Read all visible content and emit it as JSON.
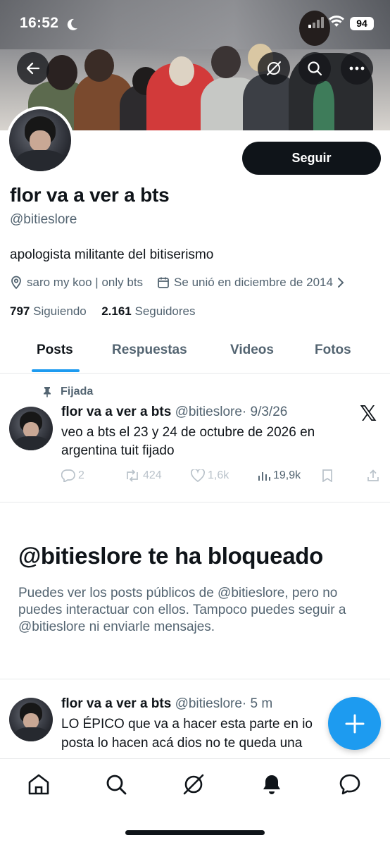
{
  "status_bar": {
    "time": "16:52",
    "battery": "94"
  },
  "header_buttons": [
    "back-arrow-icon",
    "circle-slash-icon",
    "search-icon",
    "more-icon"
  ],
  "profile": {
    "follow_label": "Seguir",
    "name": "flor va a ver a bts",
    "handle": "@bitieslore",
    "bio": "apologista militante del bitiserismo",
    "location": "saro my koo | only bts",
    "joined": "Se unió en diciembre de 2014",
    "following_count": "797",
    "following_label": "Siguiendo",
    "followers_count": "2.161",
    "followers_label": "Seguidores"
  },
  "tabs": [
    "Posts",
    "Respuestas",
    "Videos",
    "Fotos"
  ],
  "pinned_tweet": {
    "pin_label": "Fijada",
    "author": "flor va a ver a bts",
    "handle": "@bitieslore",
    "time": "· 9/3/26",
    "text": "veo a bts el 23 y 24 de octubre de 2026 en argentina tuit fijado",
    "replies": "2",
    "retweets": "424",
    "likes": "1,6k",
    "views": "19,9k"
  },
  "blocked": {
    "title": "@bitieslore te ha bloqueado",
    "text": "Puedes ver los posts públicos de @bitieslore, pero no puedes interactuar con ellos. Tampoco puedes seguir a @bitieslore ni enviarle mensajes."
  },
  "second_tweet": {
    "author": "flor va a ver a bts",
    "handle": "@bitieslore",
    "time": "· 5 m",
    "line1": "LO ÉPICO que va a hacer esta parte en io",
    "line2": "posta lo hacen acá dios no te queda una"
  },
  "bottom_nav": [
    "home-icon",
    "search-icon",
    "grok-icon",
    "bell-icon",
    "messages-icon"
  ],
  "colors": {
    "accent": "#1d9bf0",
    "text": "#0f1419",
    "secondary": "#536471"
  }
}
